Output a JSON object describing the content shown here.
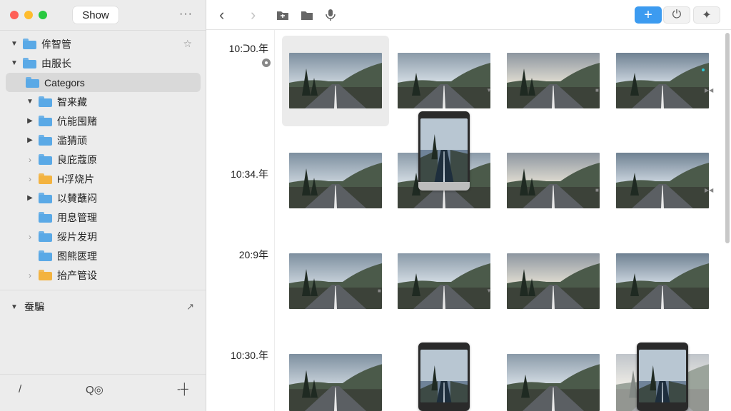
{
  "window": {
    "show_button": "Show",
    "more_icon": "ellipsis-icon"
  },
  "colors": {
    "accent": "#3c9bf0",
    "folder_blue": "#5aa9e6",
    "folder_yellow": "#f3b340",
    "close": "#fe5f57",
    "minimize": "#febc2e",
    "zoom": "#28c840"
  },
  "sidebar": {
    "items": [
      {
        "label": "侔智管",
        "expanded": true,
        "indent": 0,
        "color": "blue",
        "star": true
      },
      {
        "label": "由服长",
        "expanded": true,
        "indent": 0,
        "color": "blue"
      },
      {
        "label": "Categors",
        "selected": true,
        "indent": 0,
        "color": "blue"
      },
      {
        "label": "智来藏",
        "expanded": true,
        "indent": 1,
        "color": "blue"
      },
      {
        "label": "伉能囤赌",
        "expanded": false,
        "indent": 1,
        "color": "blue"
      },
      {
        "label": "滥猜顽",
        "expanded": false,
        "indent": 1,
        "color": "blue"
      },
      {
        "label": "良庇蔻原",
        "expanded": false,
        "hollow": true,
        "indent": 1,
        "color": "blue"
      },
      {
        "label": "H浮烧片",
        "expanded": false,
        "hollow": true,
        "indent": 1,
        "color": "yellow"
      },
      {
        "label": "以賛蘸闷",
        "expanded": false,
        "indent": 1,
        "color": "blue"
      },
      {
        "label": "用息管理",
        "indent": 1,
        "color": "blue"
      },
      {
        "label": "绥片发玥",
        "expanded": false,
        "hollow": true,
        "indent": 1,
        "color": "blue"
      },
      {
        "label": "图熊匧理",
        "indent": 1,
        "color": "blue"
      },
      {
        "label": "抬产管设",
        "expanded": false,
        "hollow": true,
        "indent": 1,
        "color": "yellow-outline"
      }
    ],
    "section": {
      "label": "蚕騙"
    },
    "bottom": {
      "left": "/",
      "center": "Q◎",
      "right": "-┼"
    }
  },
  "toolbar": {
    "back": "‹",
    "forward": "›",
    "add": "+",
    "share": "⏻",
    "sparkle": "✦"
  },
  "timeline": {
    "labels": [
      "10:ᑐ0.年",
      "10:34.年",
      "20:9年",
      "10:30.年"
    ]
  }
}
